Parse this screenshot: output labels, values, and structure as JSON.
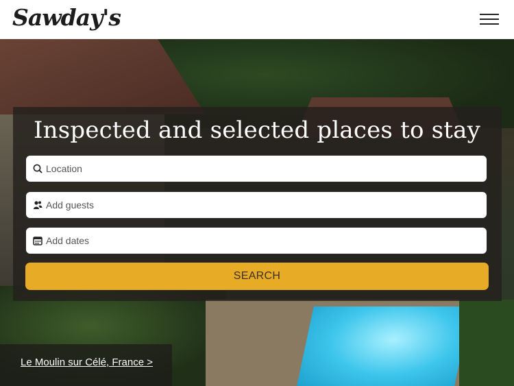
{
  "header": {
    "logo": "Sawday's",
    "menu_icon": "hamburger-menu-icon"
  },
  "hero": {
    "headline": "Inspected and selected places to stay",
    "location": {
      "placeholder": "Location",
      "icon": "search-icon"
    },
    "guests": {
      "placeholder": "Add guests",
      "icon": "guests-icon"
    },
    "dates": {
      "placeholder": "Add dates",
      "icon": "calendar-icon"
    },
    "search_label": "SEARCH",
    "caption_link": "Le Moulin sur Célé, France >"
  },
  "colors": {
    "accent": "#e8ab26",
    "panel": "#23201c",
    "text_dark": "#1c1c1c"
  }
}
